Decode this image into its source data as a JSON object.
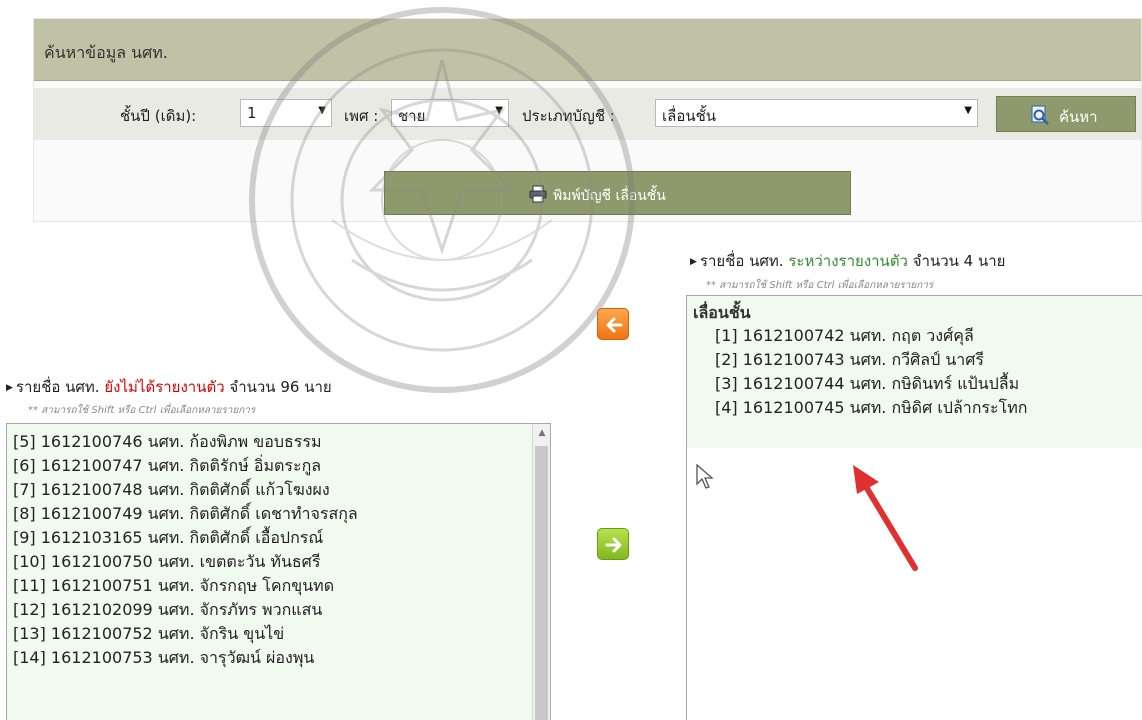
{
  "search_panel": {
    "title": "ค้นหาข้อมูล นศท.",
    "year_label": "ชั้นปี (เดิม):",
    "year_value": "1",
    "gender_label": "เพศ :",
    "gender_value": "ชาย",
    "type_label": "ประเภทบัญชี :",
    "type_value": "เลื่อนชั้น",
    "search_button": "ค้นหา",
    "print_button": "พิมพ์บัญชี เลื่อนชั้น"
  },
  "left_list": {
    "heading_prefix": "รายชื่อ นศท.",
    "heading_status": "ยังไม่ได้รายงานตัว",
    "heading_suffix": "จำนวน 96 นาย",
    "hint": "** สามารถใช้ Shift หรือ Ctrl เพื่อเลือกหลายรายการ",
    "items": [
      "[5] 1612100746 นศท. ก้องพิภพ ขอบธรรม",
      "[6] 1612100747 นศท. กิตติรักษ์ อิ่มตระกูล",
      "[7] 1612100748 นศท. กิตติศักดิ์ แก้วโฆงผง",
      "[8] 1612100749 นศท. กิตติศักดิ์ เดชาทำจรสกุล",
      "[9] 1612103165 นศท. กิตติศักดิ์ เอื้อปกรณ์",
      "[10] 1612100750 นศท. เขตตะวัน ทันธศรี",
      "[11] 1612100751 นศท. จักรกฤษ โคกขุนทด",
      "[12] 1612102099 นศท. จักรภัทร พวกแสน",
      "[13] 1612100752 นศท. จักริน ขุนไข่",
      "[14] 1612100753 นศท. จารุวัฒน์ ผ่องพุน"
    ]
  },
  "right_list": {
    "heading_prefix": "รายชื่อ นศท.",
    "heading_status": "ระหว่างรายงานตัว",
    "heading_suffix": "จำนวน 4 นาย",
    "hint": "** สามารถใช้ Shift หรือ Ctrl เพื่อเลือกหลายรายการ",
    "group_label": "เลื่อนชั้น",
    "items": [
      "[1] 1612100742 นศท. กฤต วงศ์คุลี",
      "[2] 1612100743 นศท. กวีศิลป์ นาศรี",
      "[3] 1612100744 นศท. กษิดินทร์ แป้นปลื้ม",
      "[4] 1612100745 นศท. กษิดิศ เปล้ากระโทก"
    ]
  },
  "colors": {
    "header_bar": "#bfc2a4",
    "button": "#8e9a6b",
    "list_bg": "#f1faee",
    "status_red": "#e00000",
    "status_green": "#2f8f2f",
    "move_left": "#ef7414",
    "move_right": "#82b81f",
    "annotation_arrow": "#e03030"
  },
  "icons": {
    "search": "magnifier-icon",
    "print": "printer-icon",
    "move_left": "arrow-left-icon",
    "move_right": "arrow-right-icon",
    "cursor": "mouse-pointer-icon",
    "annotation": "red-arrow-icon",
    "watermark": "university-seal-watermark"
  }
}
